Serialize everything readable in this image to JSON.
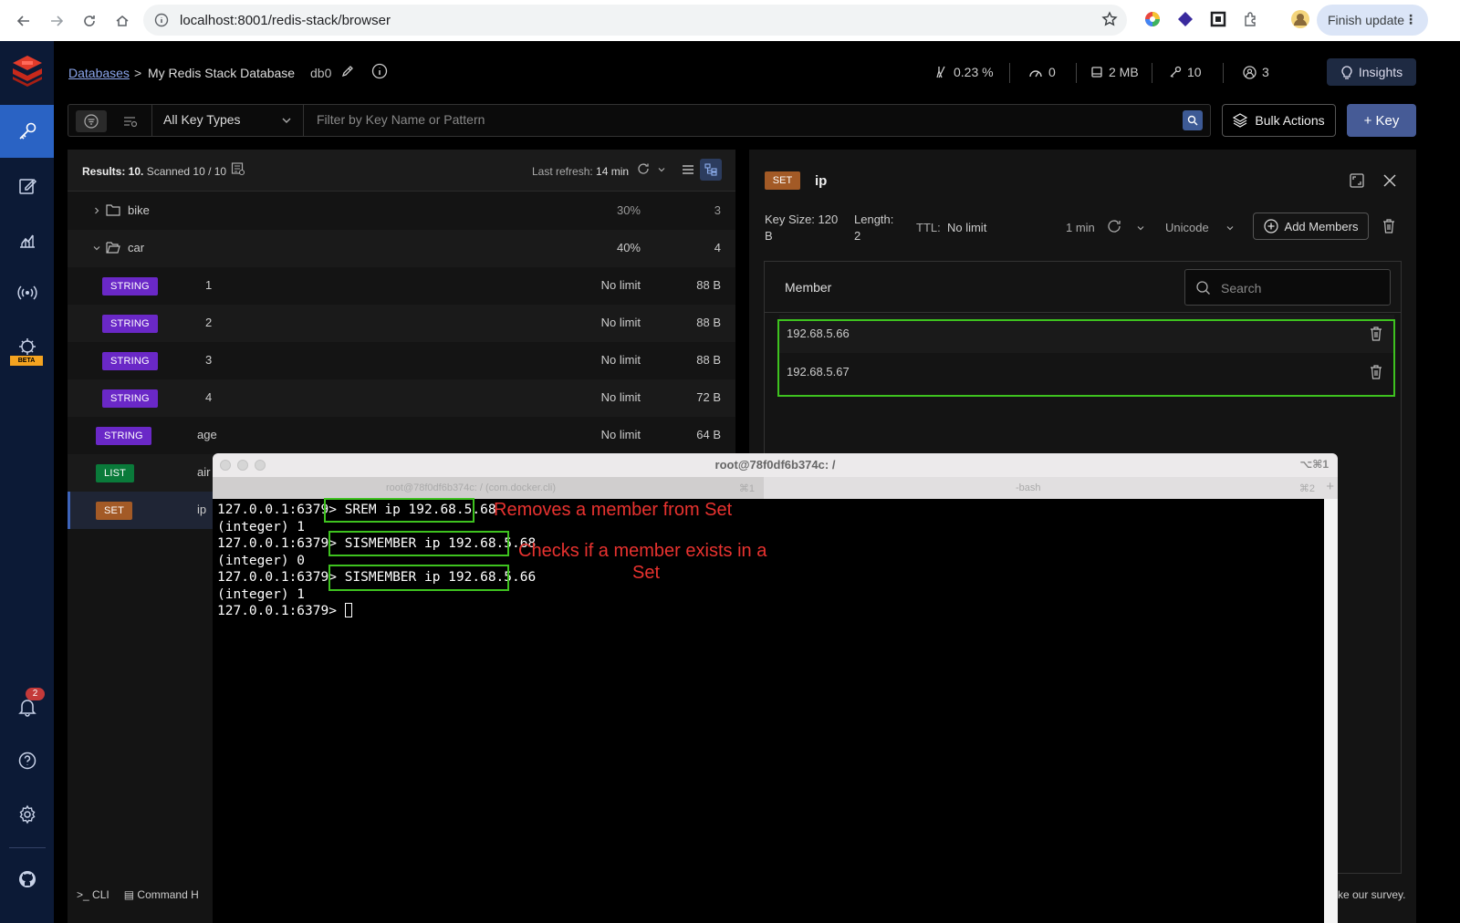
{
  "browser": {
    "url": "localhost:8001/redis-stack/browser",
    "finish_update": "Finish update"
  },
  "header": {
    "breadcrumb_databases": "Databases",
    "breadcrumb_sep": ">",
    "db_name": "My Redis Stack Database",
    "db_index": "db0",
    "stats": {
      "cpu": "0.23 %",
      "ops": "0",
      "memory": "2 MB",
      "keys": "10",
      "clients": "3"
    },
    "insights": "Insights"
  },
  "filter": {
    "key_type": "All Key Types",
    "placeholder": "Filter by Key Name or Pattern",
    "bulk_actions": "Bulk Actions",
    "add_key": "+ Key"
  },
  "keylist": {
    "results_label": "Results: 10.",
    "scanned": "Scanned 10 / 10",
    "last_refresh_label": "Last refresh:",
    "last_refresh_value": "14 min",
    "folders": [
      {
        "name": "bike",
        "percent": "30%",
        "count": "3"
      },
      {
        "name": "car",
        "percent": "40%",
        "count": "4"
      }
    ],
    "keys": [
      {
        "type": "STRING",
        "name": "1",
        "ttl": "No limit",
        "size": "88 B"
      },
      {
        "type": "STRING",
        "name": "2",
        "ttl": "No limit",
        "size": "88 B"
      },
      {
        "type": "STRING",
        "name": "3",
        "ttl": "No limit",
        "size": "88 B"
      },
      {
        "type": "STRING",
        "name": "4",
        "ttl": "No limit",
        "size": "72 B"
      },
      {
        "type": "STRING",
        "name": "age",
        "ttl": "No limit",
        "size": "64 B"
      },
      {
        "type": "LIST",
        "name": "air"
      },
      {
        "type": "SET",
        "name": "ip"
      }
    ]
  },
  "details": {
    "type": "SET",
    "key": "ip",
    "key_size_label": "Key Size: 120",
    "key_size_unit": "B",
    "length_label": "Length:",
    "length_value": "2",
    "ttl_label": "TTL:",
    "ttl_value": "No limit",
    "refresh": "1 min",
    "format": "Unicode",
    "add_members": "Add Members",
    "column_member": "Member",
    "search_placeholder": "Search",
    "members": [
      "192.68.5.66",
      "192.68.5.67"
    ]
  },
  "bottombar": {
    "cli": "CLI",
    "command_helper": "Command H",
    "survey": "ke our survey."
  },
  "nav": {
    "beta": "BETA",
    "notifications": "2"
  },
  "terminal": {
    "title": "root@78f0df6b374c: /",
    "shortcut": "⌥⌘1",
    "tab1": "root@78f0df6b374c: / (com.docker.cli)",
    "tab1_sc": "⌘1",
    "tab2": "-bash",
    "tab2_sc": "⌘2",
    "lines": [
      {
        "prompt": "127.0.0.1:6379> ",
        "cmd": "SREM ip 192.68.5.68"
      },
      {
        "output": "(integer) 1"
      },
      {
        "prompt": "127.0.0.1:6379> ",
        "cmd": "SISMEMBER ip 192.68.5.68"
      },
      {
        "output": "(integer) 0"
      },
      {
        "prompt": "127.0.0.1:6379> ",
        "cmd": "SISMEMBER ip 192.68.5.66"
      },
      {
        "output": "(integer) 1"
      },
      {
        "prompt": "127.0.0.1:6379> "
      }
    ],
    "annotation1": "Removes a member from Set",
    "annotation2_line1": "Checks if a member exists in a",
    "annotation2_line2": "Set"
  },
  "colors": {
    "string_badge": "#6a28c7",
    "list_badge": "#0a7a3a",
    "set_badge": "#a35a26",
    "highlight_box": "#3ec21f",
    "annotation": "#e8322f"
  }
}
